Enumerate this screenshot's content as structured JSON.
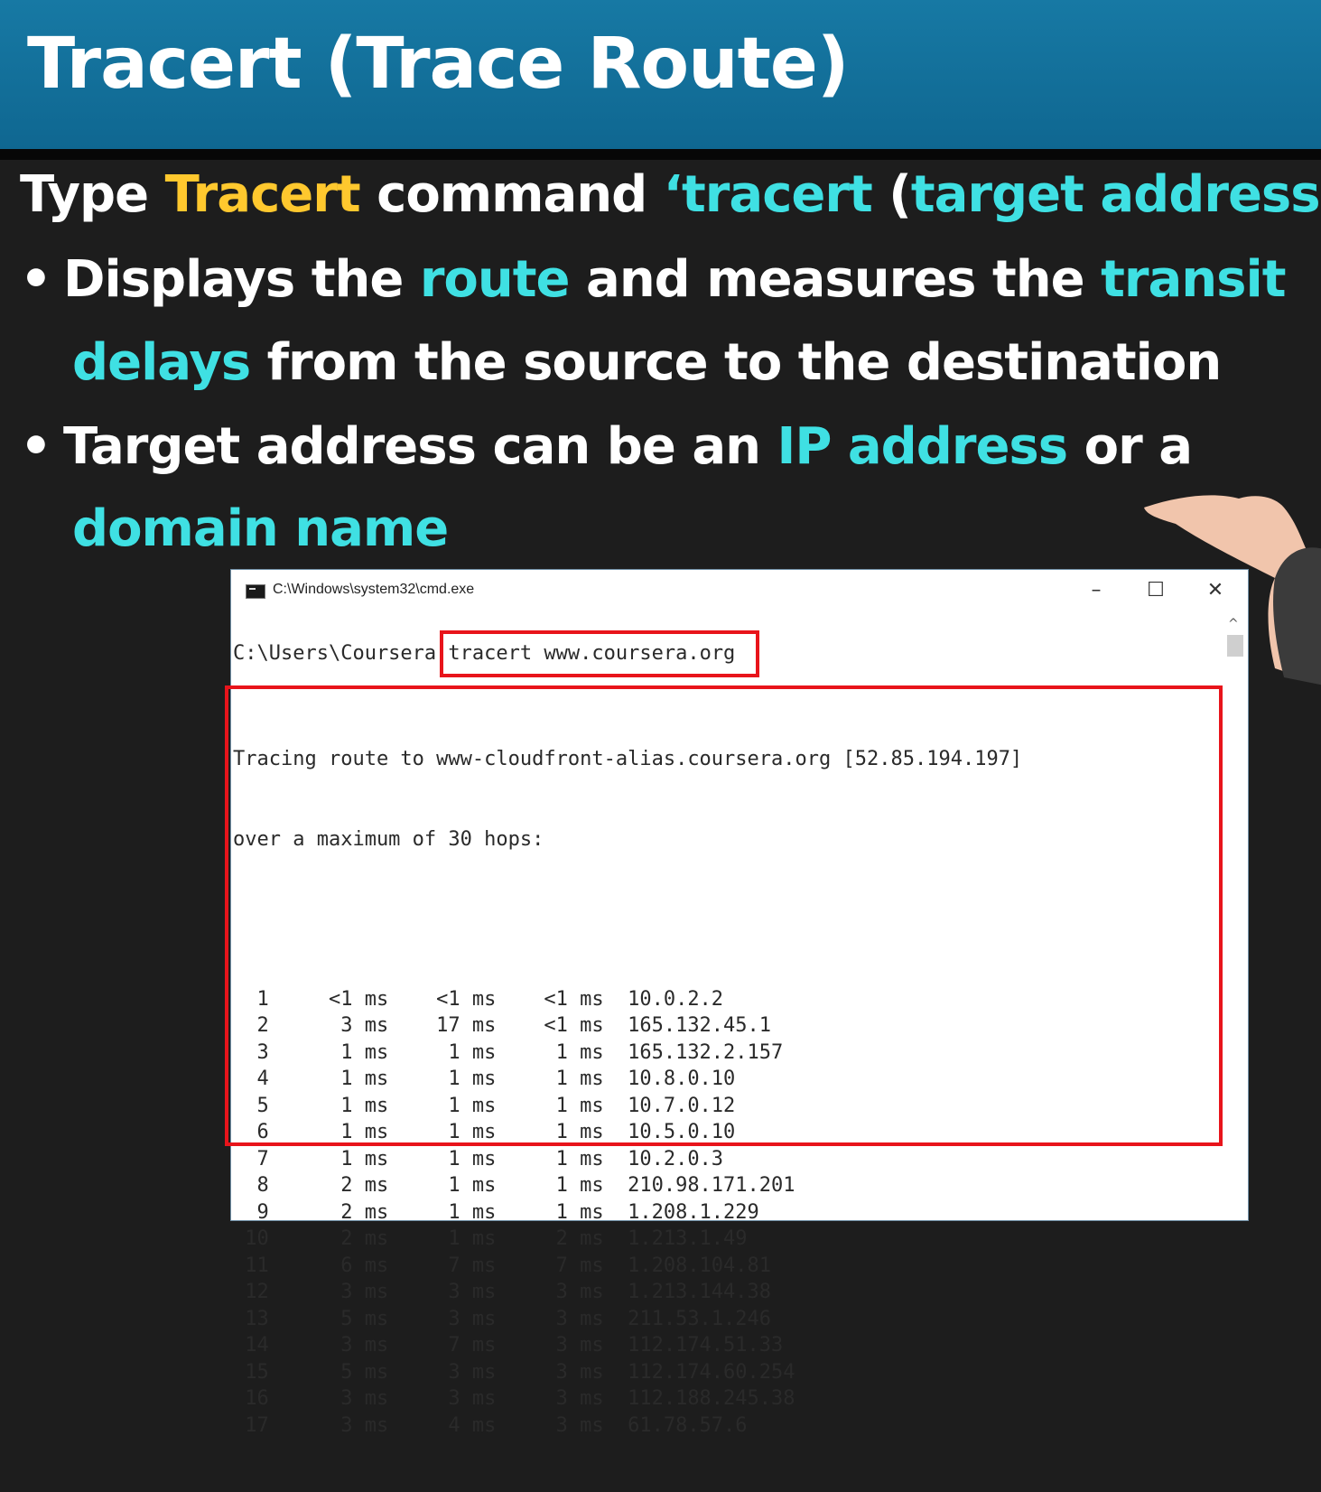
{
  "slide": {
    "title": "Tracert (Trace Route)",
    "line1": {
      "a": "Type ",
      "b": "Tracert",
      "c": " command ",
      "d": "‘tracert",
      "e": " (",
      "f": "target address",
      "g": ")’"
    },
    "bullet1": {
      "symbol": "•",
      "a": "Displays the ",
      "b": "route",
      "c": " and measures the ",
      "d": "transit",
      "e": "delays",
      "f": " from the source to the destination"
    },
    "bullet2": {
      "symbol": "•",
      "a": "Target address can be an ",
      "b": "IP address",
      "c": " or a",
      "d": "domain name"
    },
    "colors": {
      "banner": "#1779a4",
      "yellow": "#ffc82e",
      "cyan": "#3fe0e3",
      "red_box": "#e8141b"
    }
  },
  "cmd_window": {
    "title": "C:\\Windows\\system32\\cmd.exe",
    "minimize": "–",
    "maximize": "☐",
    "close": "✕",
    "scroll_up": "^",
    "prompt": "C:\\Users\\Coursera",
    "command": "tracert www.coursera.org",
    "trace_header_1": "Tracing route to www-cloudfront-alias.coursera.org [52.85.194.197]",
    "trace_header_2": "over a maximum of 30 hops:",
    "hops": [
      {
        "n": "1",
        "t1": "<1 ms",
        "t2": "<1 ms",
        "t3": "<1 ms",
        "ip": "10.0.2.2"
      },
      {
        "n": "2",
        "t1": "3 ms",
        "t2": "17 ms",
        "t3": "<1 ms",
        "ip": "165.132.45.1"
      },
      {
        "n": "3",
        "t1": "1 ms",
        "t2": "1 ms",
        "t3": "1 ms",
        "ip": "165.132.2.157"
      },
      {
        "n": "4",
        "t1": "1 ms",
        "t2": "1 ms",
        "t3": "1 ms",
        "ip": "10.8.0.10"
      },
      {
        "n": "5",
        "t1": "1 ms",
        "t2": "1 ms",
        "t3": "1 ms",
        "ip": "10.7.0.12"
      },
      {
        "n": "6",
        "t1": "1 ms",
        "t2": "1 ms",
        "t3": "1 ms",
        "ip": "10.5.0.10"
      },
      {
        "n": "7",
        "t1": "1 ms",
        "t2": "1 ms",
        "t3": "1 ms",
        "ip": "10.2.0.3"
      },
      {
        "n": "8",
        "t1": "2 ms",
        "t2": "1 ms",
        "t3": "1 ms",
        "ip": "210.98.171.201"
      },
      {
        "n": "9",
        "t1": "2 ms",
        "t2": "1 ms",
        "t3": "1 ms",
        "ip": "1.208.1.229"
      },
      {
        "n": "10",
        "t1": "2 ms",
        "t2": "1 ms",
        "t3": "2 ms",
        "ip": "1.213.1.49"
      },
      {
        "n": "11",
        "t1": "6 ms",
        "t2": "7 ms",
        "t3": "7 ms",
        "ip": "1.208.104.81"
      },
      {
        "n": "12",
        "t1": "3 ms",
        "t2": "3 ms",
        "t3": "3 ms",
        "ip": "1.213.144.38"
      },
      {
        "n": "13",
        "t1": "5 ms",
        "t2": "3 ms",
        "t3": "3 ms",
        "ip": "211.53.1.246"
      },
      {
        "n": "14",
        "t1": "3 ms",
        "t2": "7 ms",
        "t3": "3 ms",
        "ip": "112.174.51.33"
      },
      {
        "n": "15",
        "t1": "5 ms",
        "t2": "3 ms",
        "t3": "3 ms",
        "ip": "112.174.60.254"
      },
      {
        "n": "16",
        "t1": "3 ms",
        "t2": "3 ms",
        "t3": "3 ms",
        "ip": "112.188.245.38"
      },
      {
        "n": "17",
        "t1": "3 ms",
        "t2": "4 ms",
        "t3": "3 ms",
        "ip": "61.78.57.6"
      }
    ]
  }
}
